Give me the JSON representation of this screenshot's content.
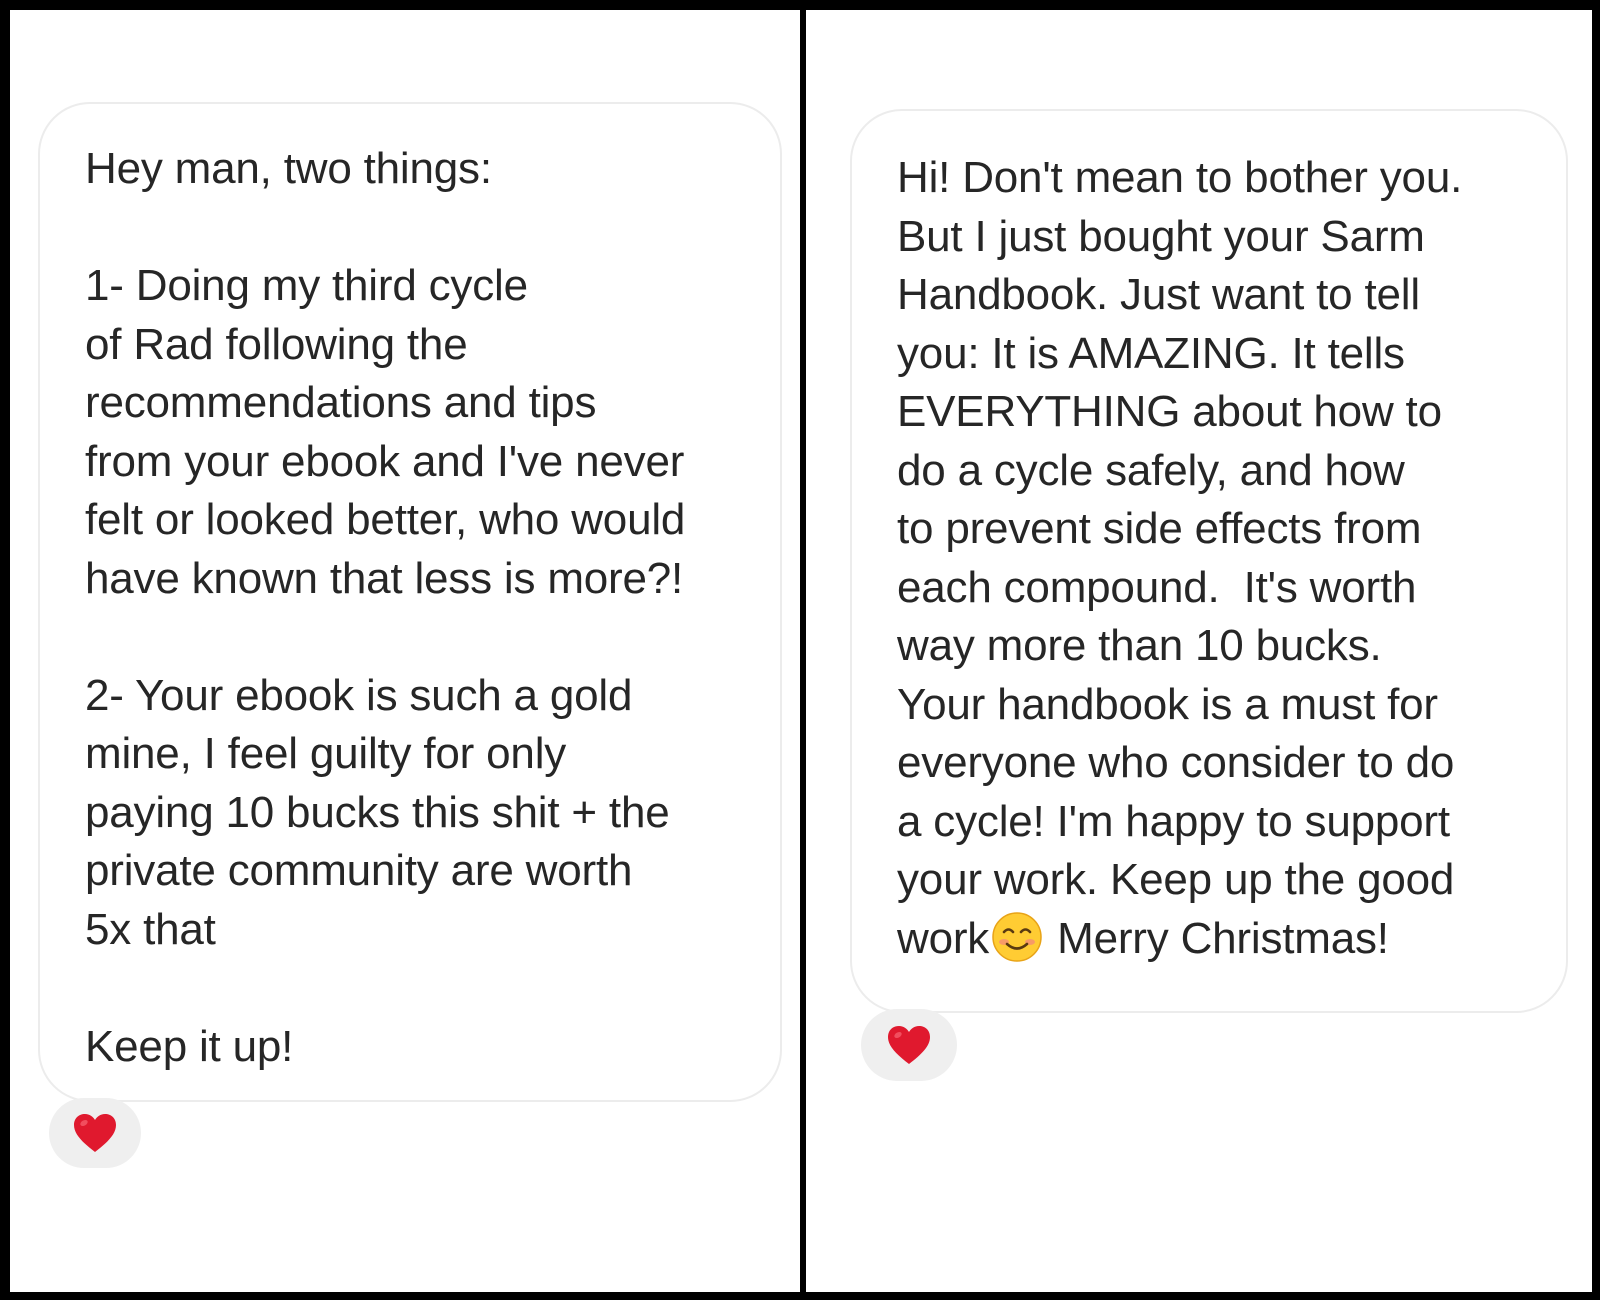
{
  "colors": {
    "frame": "#000000",
    "panel_bg": "#ffffff",
    "bubble_border": "#ececec",
    "text": "#262626",
    "reaction_bg": "#efefef",
    "heart": "#e0192e"
  },
  "left_message": {
    "lines": [
      "Hey man, two things:",
      "",
      "1- Doing my third cycle",
      "of Rad following the",
      "recommendations and tips",
      "from your ebook and I've never",
      "felt or looked better, who would",
      "have known that less is more?!",
      "",
      "2- Your ebook is such a gold",
      "mine, I feel guilty for only",
      "paying 10 bucks this shit + the",
      "private community are worth",
      "5x that",
      "",
      "Keep it up!"
    ],
    "reaction": "heart-icon"
  },
  "right_message": {
    "lines": [
      "Hi! Don't mean to bother you.",
      "But I just bought your Sarm",
      "Handbook. Just want to tell",
      "you: It is AMAZING. It tells",
      "EVERYTHING about how to",
      "do a cycle safely, and how",
      "to prevent side effects from",
      "each compound.  It's worth",
      "way more than 10 bucks.",
      "Your handbook is a must for",
      "everyone who consider to do",
      "a cycle! I'm happy to support",
      "your work. Keep up the good"
    ],
    "last_line_start": "work",
    "last_line_emoji": "smiling-face-icon",
    "last_line_end": " Merry Christmas!",
    "reaction": "heart-icon"
  }
}
